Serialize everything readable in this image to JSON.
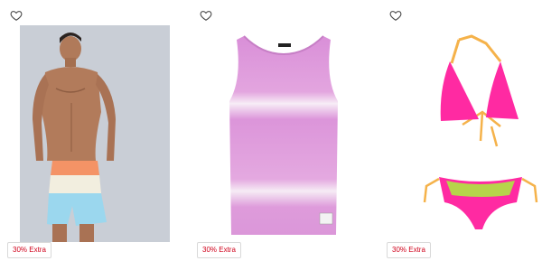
{
  "products": [
    {
      "name": "product-card-swim-shorts",
      "wishlist_icon": "heart-outline-icon",
      "image_subject": "swim-shorts-photo",
      "badge": "30% Extra"
    },
    {
      "name": "product-card-tie-dye-tank-top",
      "wishlist_icon": "heart-outline-icon",
      "image_subject": "tank-top-photo",
      "badge": "30% Extra"
    },
    {
      "name": "product-card-bikini",
      "wishlist_icon": "heart-outline-icon",
      "image_subject": "bikini-photo",
      "badge": "30% Extra"
    }
  ],
  "colors": {
    "badge_text": "#d0021b",
    "badge_border": "#d9d9d9",
    "icon_stroke": "#444444"
  }
}
